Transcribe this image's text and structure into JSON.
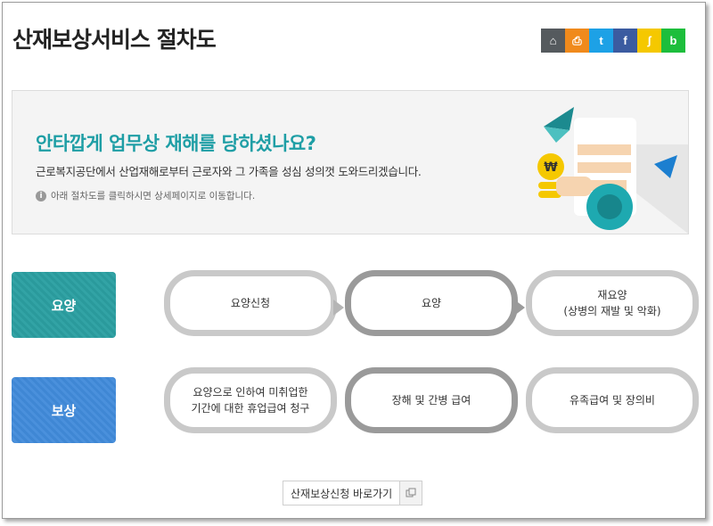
{
  "page": {
    "title": "산재보상서비스 절차도"
  },
  "sns": [
    {
      "label": "⌂",
      "icon": "home-icon",
      "color": "#555a5e"
    },
    {
      "label": "⎙",
      "icon": "print-icon",
      "color": "#f08a1c"
    },
    {
      "label": "t",
      "icon": "twitter-icon",
      "color": "#1da1e6"
    },
    {
      "label": "f",
      "icon": "facebook-icon",
      "color": "#3b5ba0"
    },
    {
      "label": "ʃ",
      "icon": "kakaostory-icon",
      "color": "#f5c800"
    },
    {
      "label": "b",
      "icon": "band-icon",
      "color": "#1dbe3c"
    }
  ],
  "banner": {
    "title": "안타깝게 업무상 재해를 당하셨나요?",
    "subtitle": "근로복지공단에서 산업재해로부터 근로자와 그 가족을 성심 성의껏 도와드리겠습니다.",
    "note": "아래 절차도를 클릭하시면 상세페이지로 이동합니다."
  },
  "categories": {
    "care": "요양",
    "compensation": "보상"
  },
  "steps": {
    "care_apply": "요양신청",
    "care": "요양",
    "recare_line1": "재요양",
    "recare_line2": "(상병의 재발 및 악화)",
    "leave_line1": "요양으로 인하여 미취업한",
    "leave_line2": "기간에 대한 휴업급여 청구",
    "disability": "장해 및 간병 급여",
    "survivor": "유족급여 및 장의비"
  },
  "bottom_button": {
    "label": "산재보상신청 바로가기"
  },
  "colors": {
    "accent": "#1e9ea5",
    "teal": "#2a9a9c",
    "blue": "#4a90dc"
  }
}
